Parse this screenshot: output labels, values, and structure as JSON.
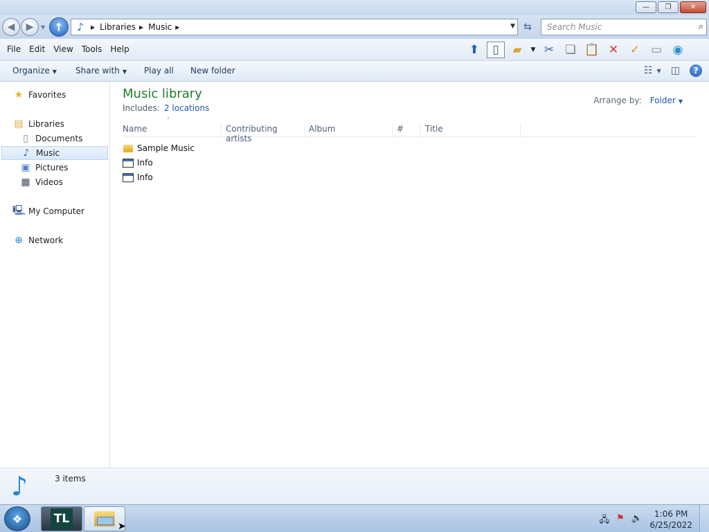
{
  "window": {
    "minimize_glyph": "—",
    "restore_glyph": "❐",
    "close_glyph": "✕"
  },
  "address": {
    "breadcrumbs": [
      "Libraries",
      "Music"
    ],
    "search_placeholder": "Search Music"
  },
  "menu": [
    "File",
    "Edit",
    "View",
    "Tools",
    "Help"
  ],
  "commands": {
    "organize": "Organize",
    "share_with": "Share with",
    "play_all": "Play all",
    "new_folder": "New folder"
  },
  "nav": {
    "favorites": "Favorites",
    "libraries": "Libraries",
    "documents": "Documents",
    "music": "Music",
    "pictures": "Pictures",
    "videos": "Videos",
    "my_computer": "My Computer",
    "network": "Network"
  },
  "library": {
    "title": "Music library",
    "includes_label": "Includes:",
    "locations_link": "2 locations",
    "arrange_by_label": "Arrange by:",
    "arrange_by_value": "Folder"
  },
  "columns": [
    "Name",
    "Contributing artists",
    "Album",
    "#",
    "Title"
  ],
  "files": [
    {
      "name": "Sample Music",
      "type": "folder"
    },
    {
      "name": "Info",
      "type": "window"
    },
    {
      "name": "Info",
      "type": "window"
    }
  ],
  "details": {
    "item_count": "3 items"
  },
  "taskbar": {
    "tl_label": "TL",
    "time": "1:06 PM",
    "date": "6/25/2022"
  },
  "colors": {
    "library_title": "#1e7a2e",
    "link": "#1d5aab",
    "selection": "#d9e8fb"
  }
}
